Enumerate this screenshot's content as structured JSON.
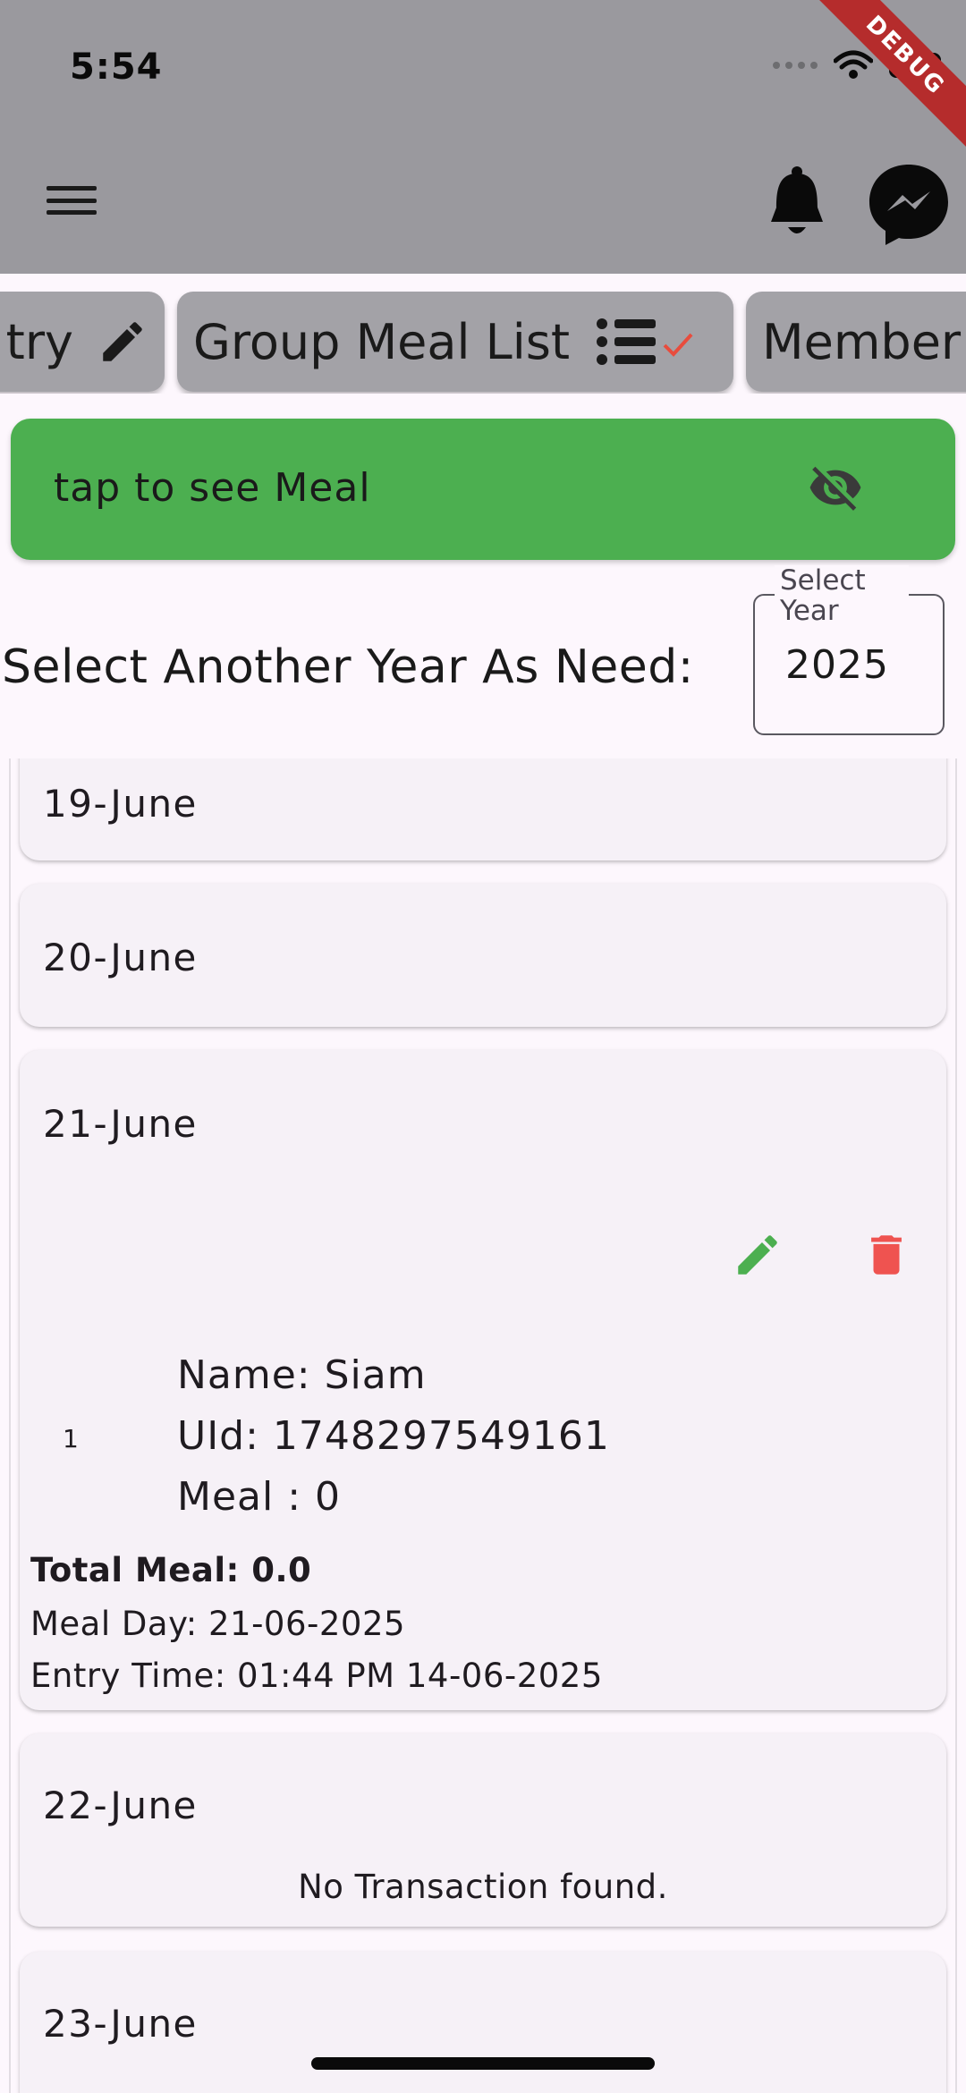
{
  "status_bar": {
    "time": "5:54"
  },
  "debug_banner": "DEBUG",
  "tabs": [
    {
      "label": "try",
      "icon": "pencil-icon"
    },
    {
      "label": "Group Meal List",
      "icon": "list-check-icon"
    },
    {
      "label": "Member"
    }
  ],
  "banner": {
    "text": "tap to see Meal",
    "icon": "eye-off-icon",
    "color": "#4caf50"
  },
  "year_selector": {
    "label": "Select Another Year As Need:",
    "field_label": "Select Year",
    "value": "2025"
  },
  "meal_days": [
    {
      "date": "19-June"
    },
    {
      "date": "20-June"
    },
    {
      "date": "21-June",
      "entries": [
        {
          "index": "1",
          "name": "Name: Siam",
          "uid": "UId: 1748297549161",
          "meal": "Meal : 0"
        }
      ],
      "total": "Total Meal: 0.0",
      "meal_day": "Meal Day: 21-06-2025",
      "entry_time": "Entry Time: 01:44 PM 14-06-2025"
    },
    {
      "date": "22-June",
      "empty_text": "No Transaction found."
    },
    {
      "date": "23-June"
    }
  ],
  "colors": {
    "edit": "#4caf50",
    "delete": "#ef5350",
    "tab_check": "#e84c3d"
  }
}
